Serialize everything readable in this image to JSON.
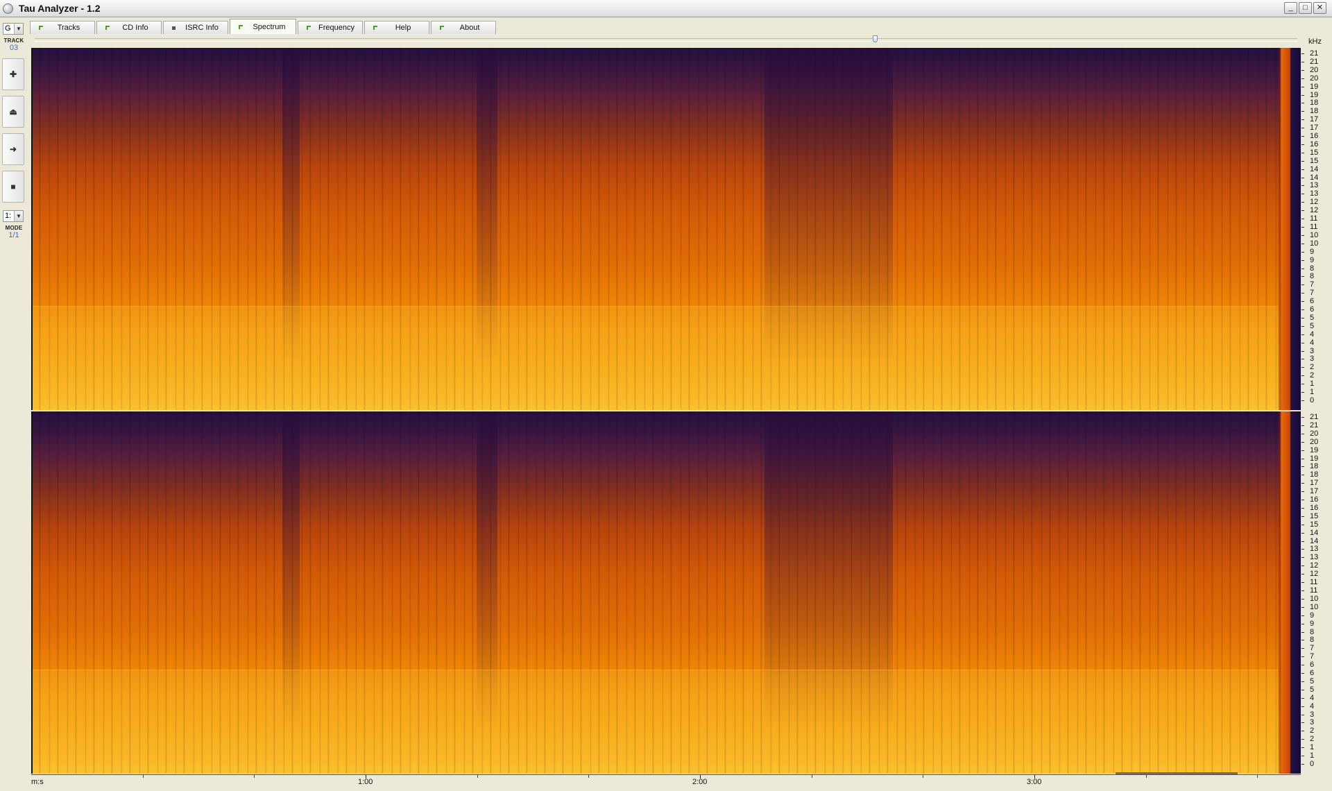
{
  "window": {
    "title": "Tau Analyzer - 1.2"
  },
  "window_controls": {
    "minimize": "_",
    "maximize": "□",
    "close": "✕"
  },
  "tabs": [
    {
      "label": "Tracks"
    },
    {
      "label": "CD Info"
    },
    {
      "label": "ISRC Info"
    },
    {
      "label": "Spectrum",
      "active": true
    },
    {
      "label": "Frequency"
    },
    {
      "label": "Help"
    },
    {
      "label": "About"
    }
  ],
  "sidebar": {
    "drive_select": "G",
    "track_label": "TRACK",
    "track_number": "03",
    "buttons": [
      {
        "name": "add",
        "glyph": "✚"
      },
      {
        "name": "eject",
        "glyph": "⏏"
      },
      {
        "name": "forward",
        "glyph": "➜"
      },
      {
        "name": "stop",
        "glyph": "■"
      }
    ],
    "ratio_select": "1:",
    "mode_label": "MODE",
    "mode_value": "1/1"
  },
  "spectrum": {
    "unit_label": "kHz",
    "freq_labels_top": [
      "21",
      "21",
      "20",
      "20",
      "19",
      "19",
      "18",
      "18",
      "17",
      "17",
      "16",
      "16",
      "15",
      "15",
      "14",
      "14",
      "13",
      "13",
      "12",
      "12",
      "11",
      "11",
      "10",
      "10",
      "9",
      "9",
      "8",
      "8",
      "7",
      "7",
      "6",
      "6",
      "5",
      "5",
      "4",
      "4",
      "3",
      "3",
      "2",
      "2",
      "1",
      "1",
      "0"
    ],
    "freq_labels_bottom": [
      "21",
      "21",
      "20",
      "20",
      "19",
      "19",
      "18",
      "18",
      "17",
      "17",
      "16",
      "16",
      "15",
      "15",
      "14",
      "14",
      "13",
      "13",
      "12",
      "12",
      "11",
      "11",
      "10",
      "10",
      "9",
      "9",
      "8",
      "8",
      "7",
      "7",
      "6",
      "6",
      "5",
      "5",
      "4",
      "4",
      "3",
      "3",
      "2",
      "2",
      "1",
      "1",
      "0"
    ],
    "channels": [
      "left",
      "right"
    ]
  },
  "time_axis": {
    "unit_label": "m:s",
    "labels": [
      "1:00",
      "2:00",
      "3:00"
    ]
  }
}
